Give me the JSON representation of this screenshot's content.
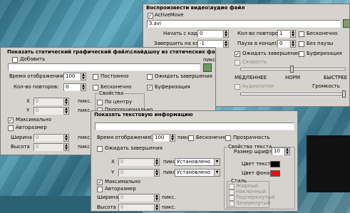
{
  "colors": {
    "text_color": "#000000",
    "bg_color": "#ee1111"
  },
  "video": {
    "title": "Воспроизвести видео\\аудио файл",
    "active_label": "ActiveMove",
    "file": "3.avi",
    "start_label": "Начать с кадра:",
    "start_val": "0",
    "end_label": "Завершить на кадре:",
    "end_val": "-1",
    "repeats_label": "Кол-во повторов:",
    "repeats_val": "1",
    "pause_label": "Пауза в конце(мс):",
    "pause_val": "0",
    "infinite_label": "Бесконечно",
    "no_pause_label": "Без паузы",
    "wait_label": "Ожидать завершения",
    "buffer_label": "Буферизация",
    "speed_label": "Скорость",
    "speed_slow": "МЕДЛЕННЕЕ",
    "speed_norm": "НОРМ",
    "speed_fast": "БЫСТРЕЕ",
    "sound_label": "Аудиопоток",
    "volume_label": "Громкость"
  },
  "image": {
    "title": "Показать статический графический файл\\слайдшоу из статических файлов",
    "add_label": "Добавить",
    "px": "пикс.",
    "time_label": "Время отображения(мс):",
    "time_val": "100",
    "constant_label": "Постоянно",
    "wait_label": "Ожидать завершения",
    "repeats_label": "Кол-во повторов:",
    "repeats_val": "0",
    "infinite_label": "Бесконечно",
    "buffer_label": "Буферизация",
    "props_label": "Свойства",
    "center_label": "По центру",
    "stretch_label": "Пропорционально",
    "x_label": "X",
    "x_val": "0",
    "y_label": "Y",
    "y_val": "0",
    "max_label": "Максимально",
    "auto_label": "Авторазмер",
    "width_label": "Ширина",
    "width_val": "0",
    "height_label": "Высота",
    "height_val": "0"
  },
  "text": {
    "title": "Показать текстовую информацию",
    "time_label": "Время отображения(мс):",
    "time_val": "100",
    "px": "пикс.",
    "infinite_label": "Бесконечно",
    "transparent_label": "Прозрачность",
    "wait_label": "Ожидать завершения",
    "props_label": "Свойства текста",
    "font_size_label": "Размер шрифта",
    "font_size_val": "10",
    "text_color_label": "Цвет текста:",
    "bg_color_label": "Цвет фона:",
    "x_label": "X",
    "x_val": "0",
    "x_mode": "Установлено",
    "y_label": "Y",
    "y_val": "0",
    "y_mode": "Установлено",
    "max_label": "Максимально",
    "auto_label": "Авторазмер",
    "width_label": "Ширина",
    "width_val": "0",
    "height_label": "Высота",
    "height_val": "0",
    "style_label": "Стиль",
    "bold_label": "Жирный",
    "italic_label": "Наклонный",
    "underline_label": "Подчеркнутый",
    "strike_label": "Зачеркнутый"
  }
}
